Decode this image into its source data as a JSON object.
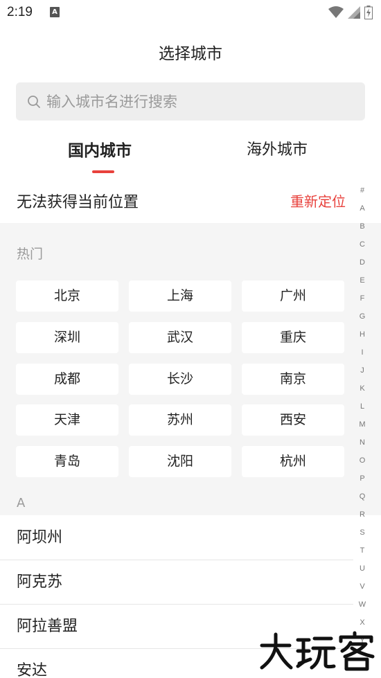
{
  "status_bar": {
    "time": "2:19",
    "notification_icon": "a-icon",
    "icons": [
      "wifi-icon",
      "signal-icon",
      "battery-charging-icon"
    ]
  },
  "header": {
    "title": "选择城市"
  },
  "search": {
    "placeholder": "输入城市名进行搜索",
    "value": ""
  },
  "tabs": [
    {
      "label": "国内城市",
      "active": true
    },
    {
      "label": "海外城市",
      "active": false
    }
  ],
  "location": {
    "status": "无法获得当前位置",
    "action": "重新定位"
  },
  "hot": {
    "title": "热门",
    "cities": [
      "北京",
      "上海",
      "广州",
      "深圳",
      "武汉",
      "重庆",
      "成都",
      "长沙",
      "南京",
      "天津",
      "苏州",
      "西安",
      "青岛",
      "沈阳",
      "杭州"
    ]
  },
  "section_a": {
    "letter": "A",
    "cities": [
      "阿坝州",
      "阿克苏",
      "阿拉善盟",
      "安达"
    ]
  },
  "index_letters": [
    "#",
    "A",
    "B",
    "C",
    "D",
    "E",
    "F",
    "G",
    "H",
    "I",
    "J",
    "K",
    "L",
    "M",
    "N",
    "O",
    "P",
    "Q",
    "R",
    "S",
    "T",
    "U",
    "V",
    "W",
    "X",
    "Y"
  ],
  "colors": {
    "accent": "#e8413c",
    "gray_bg": "#f5f5f5",
    "search_bg": "#eeeeee"
  }
}
